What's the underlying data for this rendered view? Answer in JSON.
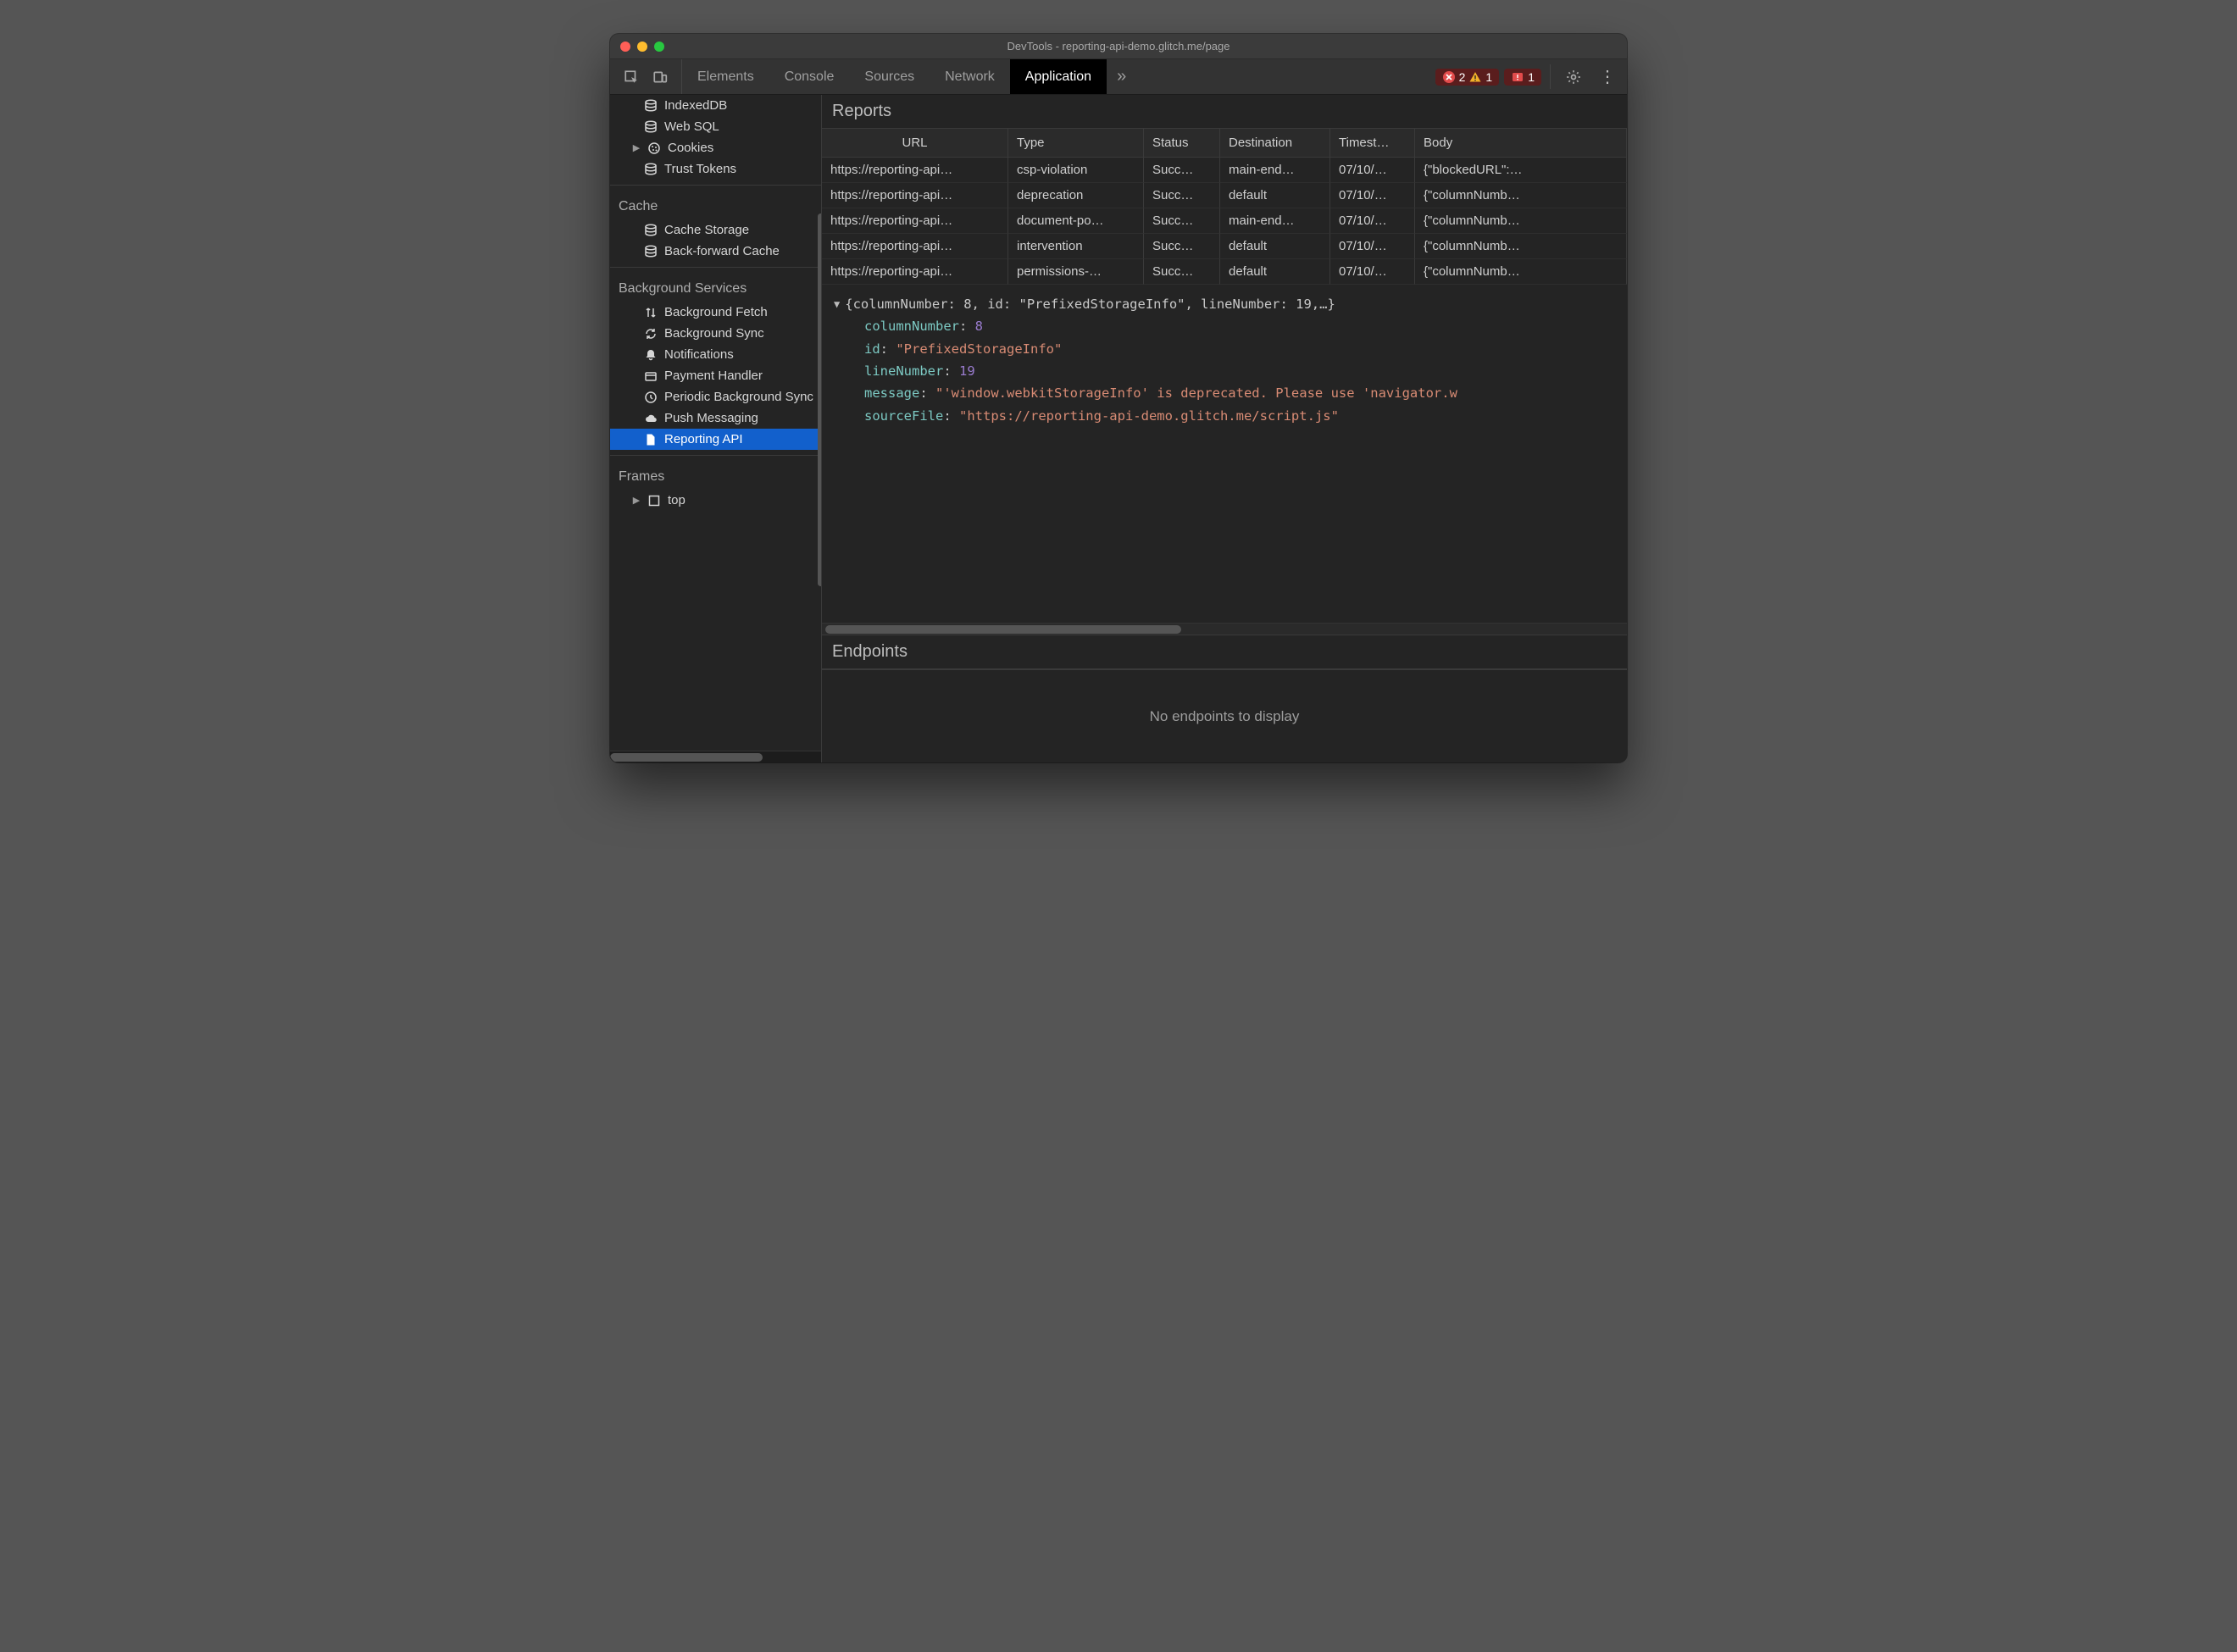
{
  "window": {
    "title": "DevTools - reporting-api-demo.glitch.me/page"
  },
  "toolbar": {
    "tabs": [
      {
        "label": "Elements",
        "active": false
      },
      {
        "label": "Console",
        "active": false
      },
      {
        "label": "Sources",
        "active": false
      },
      {
        "label": "Network",
        "active": false
      },
      {
        "label": "Application",
        "active": true
      }
    ],
    "badges": {
      "errors": "2",
      "warnings": "1",
      "issues": "1"
    }
  },
  "sidebar": {
    "storage_items": [
      {
        "label": "IndexedDB",
        "icon": "database",
        "caret": false
      },
      {
        "label": "Web SQL",
        "icon": "database",
        "caret": false
      },
      {
        "label": "Cookies",
        "icon": "cookie",
        "caret": true
      },
      {
        "label": "Trust Tokens",
        "icon": "database",
        "caret": false
      }
    ],
    "cache": {
      "title": "Cache",
      "items": [
        {
          "label": "Cache Storage",
          "icon": "database"
        },
        {
          "label": "Back-forward Cache",
          "icon": "database"
        }
      ]
    },
    "bg": {
      "title": "Background Services",
      "items": [
        {
          "label": "Background Fetch",
          "icon": "updown"
        },
        {
          "label": "Background Sync",
          "icon": "sync"
        },
        {
          "label": "Notifications",
          "icon": "bell"
        },
        {
          "label": "Payment Handler",
          "icon": "card"
        },
        {
          "label": "Periodic Background Sync",
          "icon": "clock"
        },
        {
          "label": "Push Messaging",
          "icon": "cloud"
        },
        {
          "label": "Reporting API",
          "icon": "file",
          "selected": true
        }
      ]
    },
    "frames": {
      "title": "Frames",
      "items": [
        {
          "label": "top",
          "icon": "frame",
          "caret": true
        }
      ]
    }
  },
  "reports": {
    "title": "Reports",
    "columns": [
      "URL",
      "Type",
      "Status",
      "Destination",
      "Timest…",
      "Body"
    ],
    "rows": [
      {
        "url": "https://reporting-api…",
        "type": "csp-violation",
        "status": "Succ…",
        "dest": "main-end…",
        "ts": "07/10/…",
        "body": "{\"blockedURL\":…"
      },
      {
        "url": "https://reporting-api…",
        "type": "deprecation",
        "status": "Succ…",
        "dest": "default",
        "ts": "07/10/…",
        "body": "{\"columnNumb…"
      },
      {
        "url": "https://reporting-api…",
        "type": "document-po…",
        "status": "Succ…",
        "dest": "main-end…",
        "ts": "07/10/…",
        "body": "{\"columnNumb…"
      },
      {
        "url": "https://reporting-api…",
        "type": "intervention",
        "status": "Succ…",
        "dest": "default",
        "ts": "07/10/…",
        "body": "{\"columnNumb…"
      },
      {
        "url": "https://reporting-api…",
        "type": "permissions-…",
        "status": "Succ…",
        "dest": "default",
        "ts": "07/10/…",
        "body": "{\"columnNumb…"
      }
    ]
  },
  "detail": {
    "summary": "{columnNumber: 8, id: \"PrefixedStorageInfo\", lineNumber: 19,…}",
    "columnNumber_k": "columnNumber",
    "columnNumber_v": "8",
    "id_k": "id",
    "id_v": "\"PrefixedStorageInfo\"",
    "lineNumber_k": "lineNumber",
    "lineNumber_v": "19",
    "message_k": "message",
    "message_v": "\"'window.webkitStorageInfo' is deprecated. Please use 'navigator.w",
    "sourceFile_k": "sourceFile",
    "sourceFile_v": "\"https://reporting-api-demo.glitch.me/script.js\""
  },
  "endpoints": {
    "title": "Endpoints",
    "empty_text": "No endpoints to display"
  }
}
